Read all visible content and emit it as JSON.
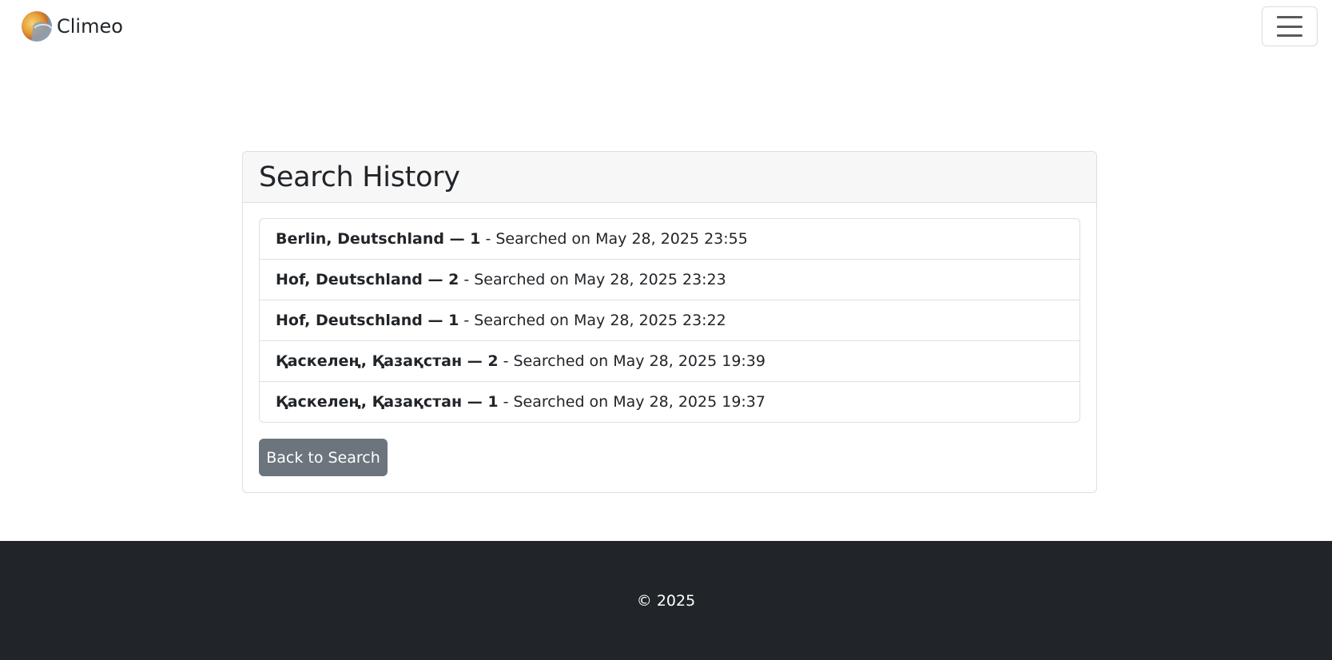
{
  "brand": {
    "name": "Climeo",
    "logo_icon": "sun-cloud-logo-icon"
  },
  "navbar": {
    "toggler_icon": "hamburger-menu-icon"
  },
  "card": {
    "title": "Search History"
  },
  "history": [
    {
      "location": "Berlin, Deutschland — 1",
      "searched": "- Searched on May 28, 2025 23:55"
    },
    {
      "location": "Hof, Deutschland — 2",
      "searched": "- Searched on May 28, 2025 23:23"
    },
    {
      "location": "Hof, Deutschland — 1",
      "searched": "- Searched on May 28, 2025 23:22"
    },
    {
      "location": "Қаскелең, Қазақстан — 2",
      "searched": "- Searched on May 28, 2025 19:39"
    },
    {
      "location": "Қаскелең, Қазақстан — 1",
      "searched": "- Searched on May 28, 2025 19:37"
    }
  ],
  "actions": {
    "back_label": "Back to Search"
  },
  "footer": {
    "text": "© 2025"
  },
  "colors": {
    "footer_bg": "#212529",
    "button_bg": "#6c757d",
    "card_header_bg": "#f7f7f7"
  }
}
